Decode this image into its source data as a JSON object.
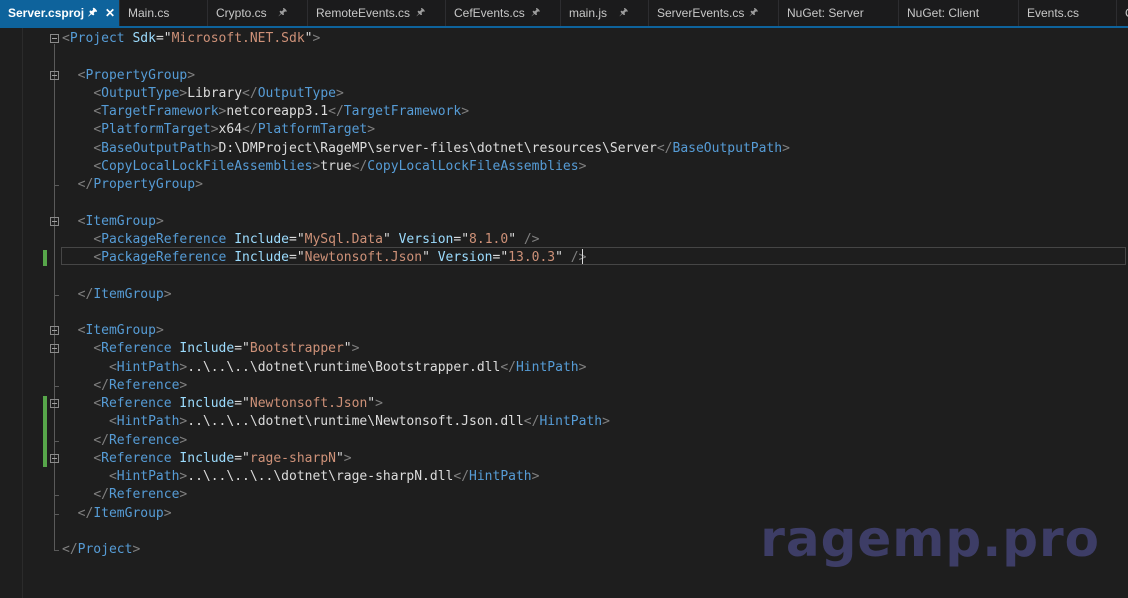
{
  "tabs": [
    {
      "label": "Server.csproj",
      "pinned": true,
      "active": true,
      "closable": true
    },
    {
      "label": "Main.cs",
      "pinned": false
    },
    {
      "label": "Crypto.cs",
      "pinned": true
    },
    {
      "label": "RemoteEvents.cs",
      "pinned": true
    },
    {
      "label": "CefEvents.cs",
      "pinned": true
    },
    {
      "label": "main.js",
      "pinned": true
    },
    {
      "label": "ServerEvents.cs",
      "pinned": true
    },
    {
      "label": "NuGet: Server",
      "pinned": false
    },
    {
      "label": "NuGet: Client",
      "pinned": false
    },
    {
      "label": "Events.cs",
      "pinned": false
    },
    {
      "label": "C",
      "pinned": false
    }
  ],
  "icons": {
    "pin": "pin-icon",
    "close": "close-icon",
    "fold": "fold-collapse-icon"
  },
  "colors": {
    "tag_bracket": "#808080",
    "element": "#569cd6",
    "attribute": "#9cdcfe",
    "attr_value": "#ce9178",
    "text": "#dcdcdc",
    "change_marker": "#57a64a",
    "active_tab": "#0e639c"
  },
  "editor": {
    "lines": [
      "<Project Sdk=\"Microsoft.NET.Sdk\">",
      "",
      "  <PropertyGroup>",
      "    <OutputType>Library</OutputType>",
      "    <TargetFramework>netcoreapp3.1</TargetFramework>",
      "    <PlatformTarget>x64</PlatformTarget>",
      "    <BaseOutputPath>D:\\DMProject\\RageMP\\server-files\\dotnet\\resources\\Server</BaseOutputPath>",
      "    <CopyLocalLockFileAssemblies>true</CopyLocalLockFileAssemblies>",
      "  </PropertyGroup>",
      "",
      "  <ItemGroup>",
      "    <PackageReference Include=\"MySql.Data\" Version=\"8.1.0\" />",
      "    <PackageReference Include=\"Newtonsoft.Json\" Version=\"13.0.3\" />",
      "",
      "  </ItemGroup>",
      "",
      "  <ItemGroup>",
      "    <Reference Include=\"Bootstrapper\">",
      "      <HintPath>..\\..\\..\\dotnet\\runtime\\Bootstrapper.dll</HintPath>",
      "    </Reference>",
      "    <Reference Include=\"Newtonsoft.Json\">",
      "      <HintPath>..\\..\\..\\dotnet\\runtime\\Newtonsoft.Json.dll</HintPath>",
      "    </Reference>",
      "    <Reference Include=\"rage-sharpN\">",
      "      <HintPath>..\\..\\..\\..\\dotnet\\rage-sharpN.dll</HintPath>",
      "    </Reference>",
      "  </ItemGroup>",
      "",
      "</Project>"
    ],
    "current_line": 13,
    "changed_lines": [
      13,
      21,
      22,
      23,
      24
    ],
    "fold_lines": [
      1,
      3,
      11,
      17,
      18,
      21,
      24
    ]
  },
  "watermark": "ragemp.pro"
}
